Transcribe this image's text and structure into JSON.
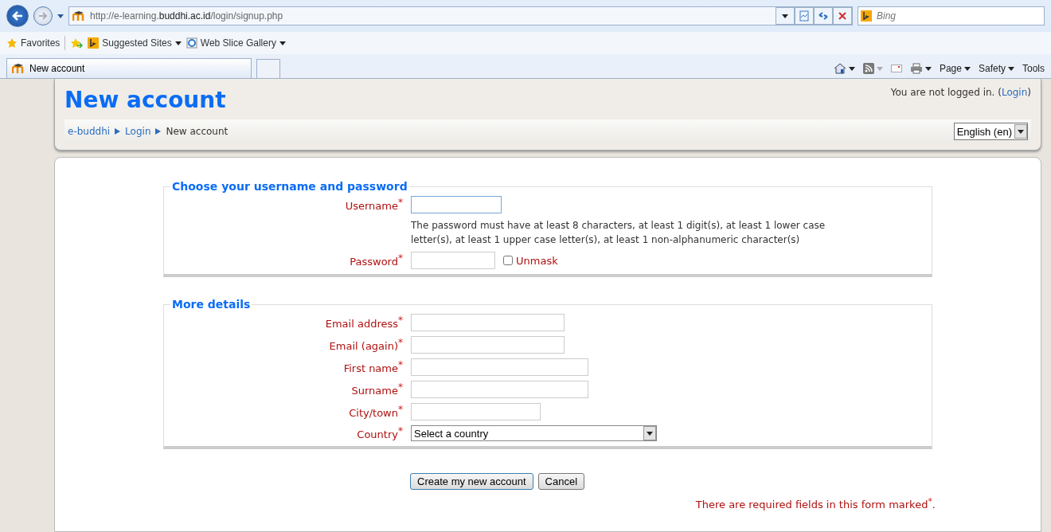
{
  "browser": {
    "address": {
      "prefix": "http://e-learning.",
      "domain": "buddhi.ac.id",
      "path": "/login/signup.php"
    },
    "search_placeholder": "Bing",
    "favorites": "Favorites",
    "favorites_bar": [
      "Suggested Sites",
      "Web Slice Gallery"
    ],
    "tab": {
      "title": "New account",
      "selected": true
    },
    "command_bar": [
      "Page",
      "Safety",
      "Tools"
    ]
  },
  "header": {
    "title": "New account",
    "login_info": "You are not logged in. (",
    "login_link": "Login",
    "login_close": ")",
    "breadcrumb": [
      {
        "label": "e-buddhi",
        "link": true
      },
      {
        "label": "Login",
        "link": true
      },
      {
        "label": "New account",
        "link": false
      }
    ],
    "language": "English (en)"
  },
  "sections": [
    {
      "legend": "Choose your username and password",
      "fields": [
        {
          "label": "Username",
          "mark": "*",
          "kind": "text",
          "focused": true
        },
        {
          "kind": "note",
          "text": "The password must have at least 8 characters, at least 1 digit(s), at least 1 lower case letter(s), at least 1 upper case letter(s), at least 1 non-alphanumeric character(s)"
        },
        {
          "label": "Password",
          "mark": "*",
          "kind": "password",
          "checkbox_label": "Unmask",
          "checked": false
        }
      ]
    },
    {
      "legend": "More details",
      "fields": [
        {
          "label": "Email address",
          "mark": "*",
          "kind": "text",
          "focused": false
        },
        {
          "label": "Email (again)",
          "mark": "*",
          "kind": "text",
          "focused": false
        },
        {
          "label": "First name",
          "mark": "*",
          "kind": "text",
          "focused": false
        },
        {
          "label": "Surname",
          "mark": "*",
          "kind": "text",
          "focused": false
        },
        {
          "label": "City/town",
          "mark": "*",
          "kind": "text",
          "focused": false
        },
        {
          "label": "Country",
          "mark": "*",
          "kind": "select",
          "value": "Select a country"
        }
      ]
    }
  ],
  "buttons": [
    {
      "label": "Create my new account",
      "primary": true
    },
    {
      "label": "Cancel",
      "primary": false
    }
  ],
  "required_note": "There are required fields in this form marked$^{*}$."
}
